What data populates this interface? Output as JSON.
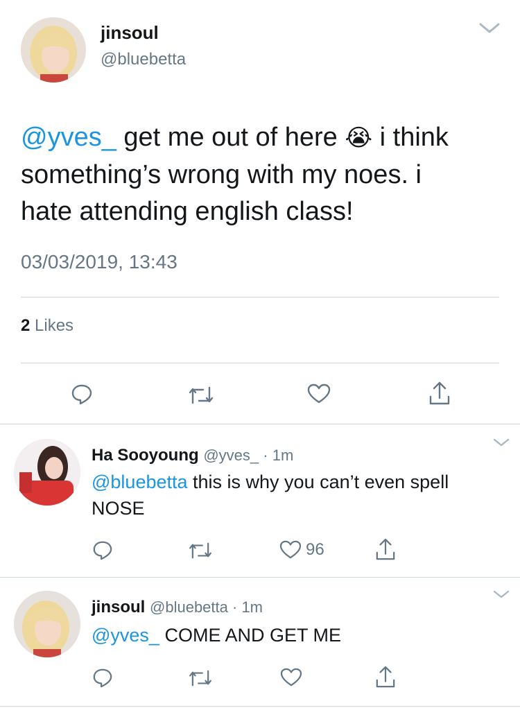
{
  "main_tweet": {
    "display_name": "jinsoul",
    "handle": "@bluebetta",
    "mention": "@yves_",
    "text_line1_after_mention": " get me out of here ",
    "emoji": "😭",
    "text_line1_tail": " i think",
    "text_line2": "something’s wrong with my noes. i",
    "text_line3": "hate attending english class!",
    "timestamp": "03/03/2019, 13:43",
    "likes_count": "2",
    "likes_label": " Likes",
    "actions": [
      "reply-icon",
      "retweet-icon",
      "heart-icon",
      "share-icon"
    ]
  },
  "replies": [
    {
      "display_name": "Ha Sooyoung",
      "handle": "@yves_",
      "dot": " · ",
      "time": "1m",
      "mention": "@bluebetta",
      "text_after_mention": " this is why you can’t even spell",
      "text_line2": "NOSE",
      "like_count": "96"
    },
    {
      "display_name": "jinsoul",
      "handle": "@bluebetta",
      "dot": " · ",
      "time": "1m",
      "mention": "@yves_",
      "text_after_mention": " COME AND GET ME"
    }
  ],
  "colors": {
    "accent": "#1b95e0",
    "text": "#14171a",
    "secondary": "#657786",
    "divider": "#ccd6dd"
  }
}
